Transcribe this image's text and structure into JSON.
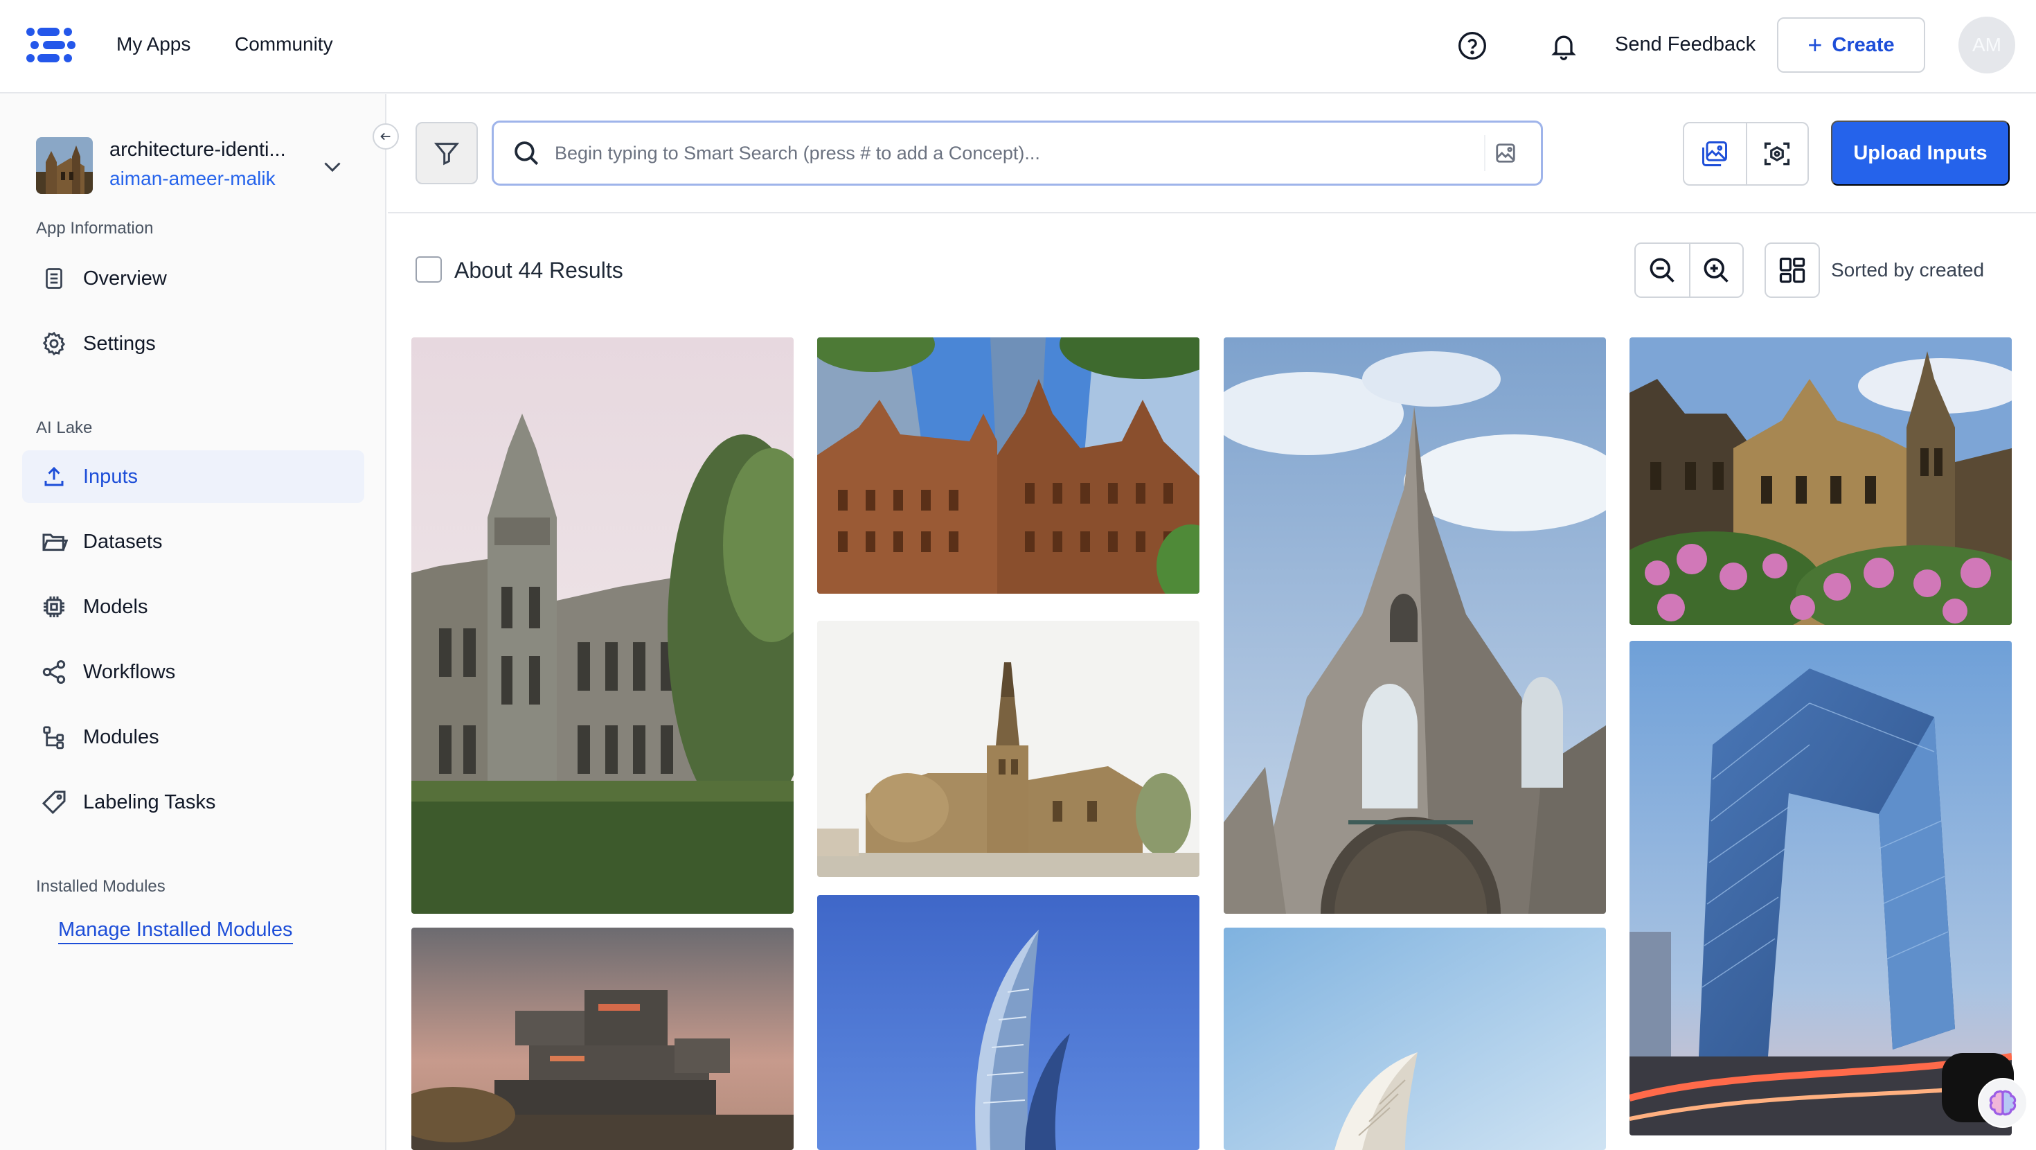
{
  "topbar": {
    "nav": [
      "My Apps",
      "Community"
    ],
    "send_feedback": "Send Feedback",
    "create_label": "Create",
    "avatar_initials": "AM"
  },
  "sidebar": {
    "app_name": "architecture-identi...",
    "app_owner": "aiman-ameer-malik",
    "sections": {
      "app_information": "App Information",
      "ai_lake": "AI Lake",
      "installed_modules": "Installed Modules"
    },
    "app_info_items": [
      {
        "label": "Overview",
        "icon": "document-icon"
      },
      {
        "label": "Settings",
        "icon": "gear-icon"
      }
    ],
    "ai_lake_items": [
      {
        "label": "Inputs",
        "icon": "upload-icon",
        "active": true
      },
      {
        "label": "Datasets",
        "icon": "folder-icon"
      },
      {
        "label": "Models",
        "icon": "chip-icon"
      },
      {
        "label": "Workflows",
        "icon": "share-nodes-icon"
      },
      {
        "label": "Modules",
        "icon": "module-branch-icon"
      },
      {
        "label": "Labeling Tasks",
        "icon": "tag-icon"
      }
    ],
    "manage_modules": "Manage Installed Modules"
  },
  "toolbar": {
    "search_placeholder": "Begin typing to Smart Search (press # to add a Concept)...",
    "upload_label": "Upload Inputs"
  },
  "results": {
    "count_label": "About 44 Results",
    "sort_label": "Sorted by created"
  },
  "gallery": {
    "tiles": [
      {
        "subject": "gothic university tower with trees"
      },
      {
        "subject": "victorian brick buildings among glass skyscrapers"
      },
      {
        "subject": "romanesque stone church with bell tower"
      },
      {
        "subject": "stone gothic church spire against sky"
      },
      {
        "subject": "gothic university with pink flowers"
      },
      {
        "subject": "brutalist concrete building at dusk"
      },
      {
        "subject": "curved glass skyscraper against blue sky"
      },
      {
        "subject": "white shell structure against blue sky"
      },
      {
        "subject": "CCTV loop-shaped glass tower at sunset"
      }
    ]
  },
  "colors": {
    "primary": "#2563eb",
    "active_bg": "#eef2fb",
    "border": "#d1d5db"
  }
}
